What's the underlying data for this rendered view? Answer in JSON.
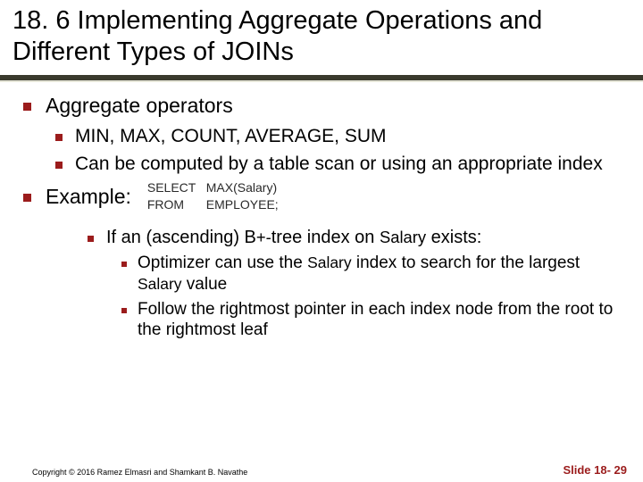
{
  "title": "18. 6 Implementing Aggregate Operations and Different Types of JOINs",
  "bullets": {
    "aggregate_operators": "Aggregate operators",
    "ops_list": "MIN, MAX, COUNT, AVERAGE, SUM",
    "computed_by": "Can be computed by a table scan or using an appropriate index",
    "example_label": "Example:",
    "if_index_prefix": "If an (ascending) B",
    "if_index_mid": "+-",
    "if_index_suffix": "tree index on ",
    "salary": "Salary",
    "exists": " exists:",
    "opt_prefix": "Optimizer can use the ",
    "opt_mid": " index to search for the largest ",
    "opt_suffix": " value",
    "follow": "Follow the rightmost pointer in each index node from the root to the rightmost leaf"
  },
  "sql": {
    "select_kw": "SELECT",
    "select_val": "MAX(Salary)",
    "from_kw": "FROM",
    "from_val": "EMPLOYEE;"
  },
  "footer": {
    "copyright": "Copyright © 2016 Ramez Elmasri and Shamkant B. Navathe",
    "slide": "Slide 18- 29"
  }
}
